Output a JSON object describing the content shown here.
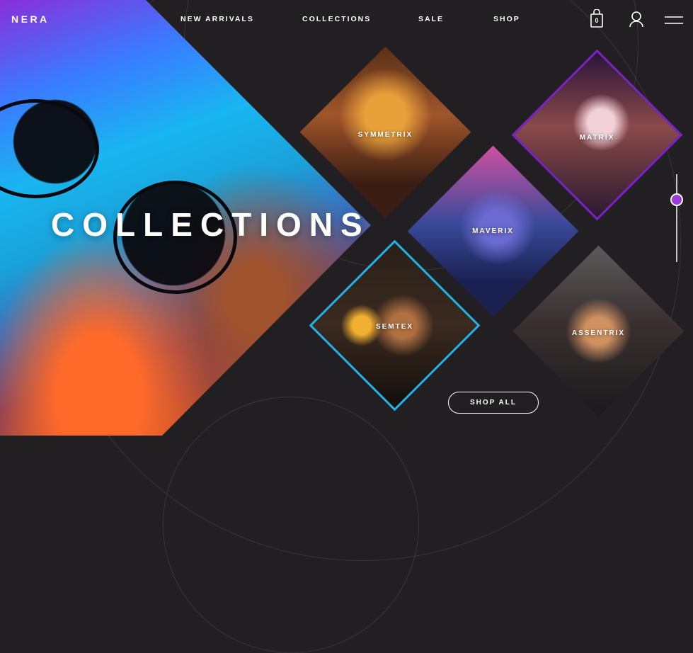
{
  "brand": {
    "logo": "NERA"
  },
  "nav": {
    "links": [
      "NEW ARRIVALS",
      "COLLECTIONS",
      "SALE",
      "SHOP"
    ]
  },
  "header_icons": {
    "bag": "shopping-bag-icon",
    "bag_count": "0",
    "user": "user-icon",
    "menu": "hamburger-menu-icon"
  },
  "hero": {
    "title": "COLLECTIONS"
  },
  "collections": [
    {
      "name": "SYMMETRIX"
    },
    {
      "name": "MATRIX"
    },
    {
      "name": "MAVERIX"
    },
    {
      "name": "SEMTEX"
    },
    {
      "name": "ASSENTRIX"
    }
  ],
  "slider": {
    "position": 0.28
  },
  "cta": {
    "shop_all": "SHOP ALL"
  },
  "colors": {
    "background": "#221f23",
    "accent_purple": "#9b3ad8",
    "accent_cyan": "#21b4e8",
    "text": "#ffffff"
  }
}
